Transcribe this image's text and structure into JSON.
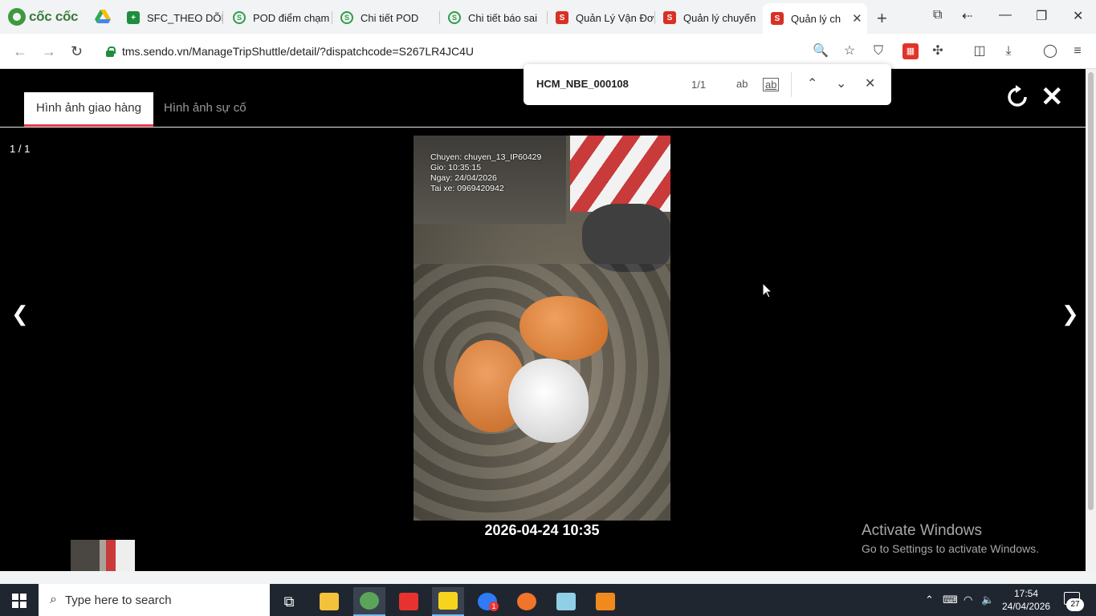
{
  "browser": {
    "brand_name": "cốc cốc",
    "tabs": [
      {
        "label": "SFC_THEO DÕI",
        "icon": "sheet-icon"
      },
      {
        "label": "POD điểm chạm",
        "icon": "sendo-icon"
      },
      {
        "label": "Chi tiết POD",
        "icon": "sendo-icon"
      },
      {
        "label": "Chi tiết báo sai",
        "icon": "sendo-icon"
      },
      {
        "label": "Quản Lý Vận Đơ",
        "icon": "sendo-red-icon"
      },
      {
        "label": "Quản lý chuyến",
        "icon": "sendo-red-icon"
      },
      {
        "label": "Quản lý ch",
        "icon": "sendo-red-icon",
        "active": true
      }
    ],
    "url": "tms.sendo.vn/ManageTripShuttle/detail/?dispatchcode=S267LR4JC4U"
  },
  "find_bar": {
    "query": "HCM_NBE_000108",
    "count": "1/1",
    "match_case_label": "ab",
    "whole_word_label": "ab"
  },
  "viewer": {
    "tabs": [
      {
        "label": "Hình ảnh giao hàng",
        "active": true
      },
      {
        "label": "Hình ảnh sự cố",
        "active": false
      }
    ],
    "counter": "1 / 1",
    "prev_arrow": "❮",
    "next_arrow": "❯",
    "photo_stamp": [
      "Chuyen: chuyen_13_IP60429",
      "Gio: 10:35:15",
      "Ngay: 24/04/2026",
      "Tai xe: 0969420942"
    ],
    "photo_datetime": "2026-04-24 10:35"
  },
  "watermark": {
    "line1": "Activate Windows",
    "line2": "Go to Settings to activate Windows."
  },
  "taskbar": {
    "search_placeholder": "Type here to search",
    "time": "17:54",
    "date": "24/04/2026",
    "notification_count": "27",
    "chat_badge": "1"
  },
  "colors": {
    "accent_tab_underline": "#e73c4e",
    "sendo_red": "#d93025",
    "coccoc_green": "#3c9a3c"
  }
}
